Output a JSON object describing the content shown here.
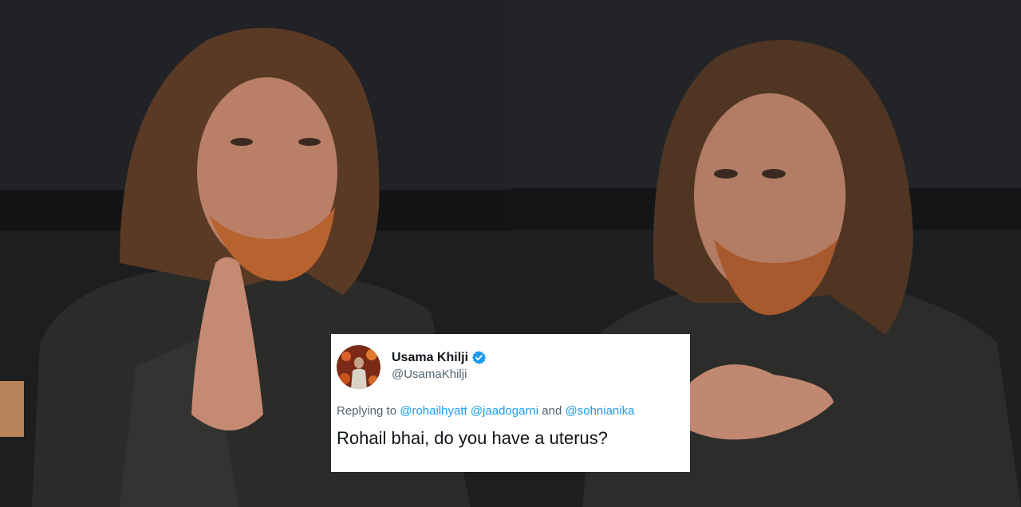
{
  "tweet": {
    "display_name": "Usama Khilji",
    "handle": "@UsamaKhilji",
    "reply_prefix": "Replying to",
    "mentions": [
      "@rohailhyatt",
      "@jaadogarni",
      "@sohnianika"
    ],
    "conjunction": "and",
    "text": "Rohail bhai, do you have a uterus?"
  },
  "colors": {
    "mention": "#1d9bf0",
    "verified_badge": "#1d9bf0",
    "background_wall": "#1f2124"
  },
  "icons": {
    "verified": "verified-badge-icon"
  }
}
